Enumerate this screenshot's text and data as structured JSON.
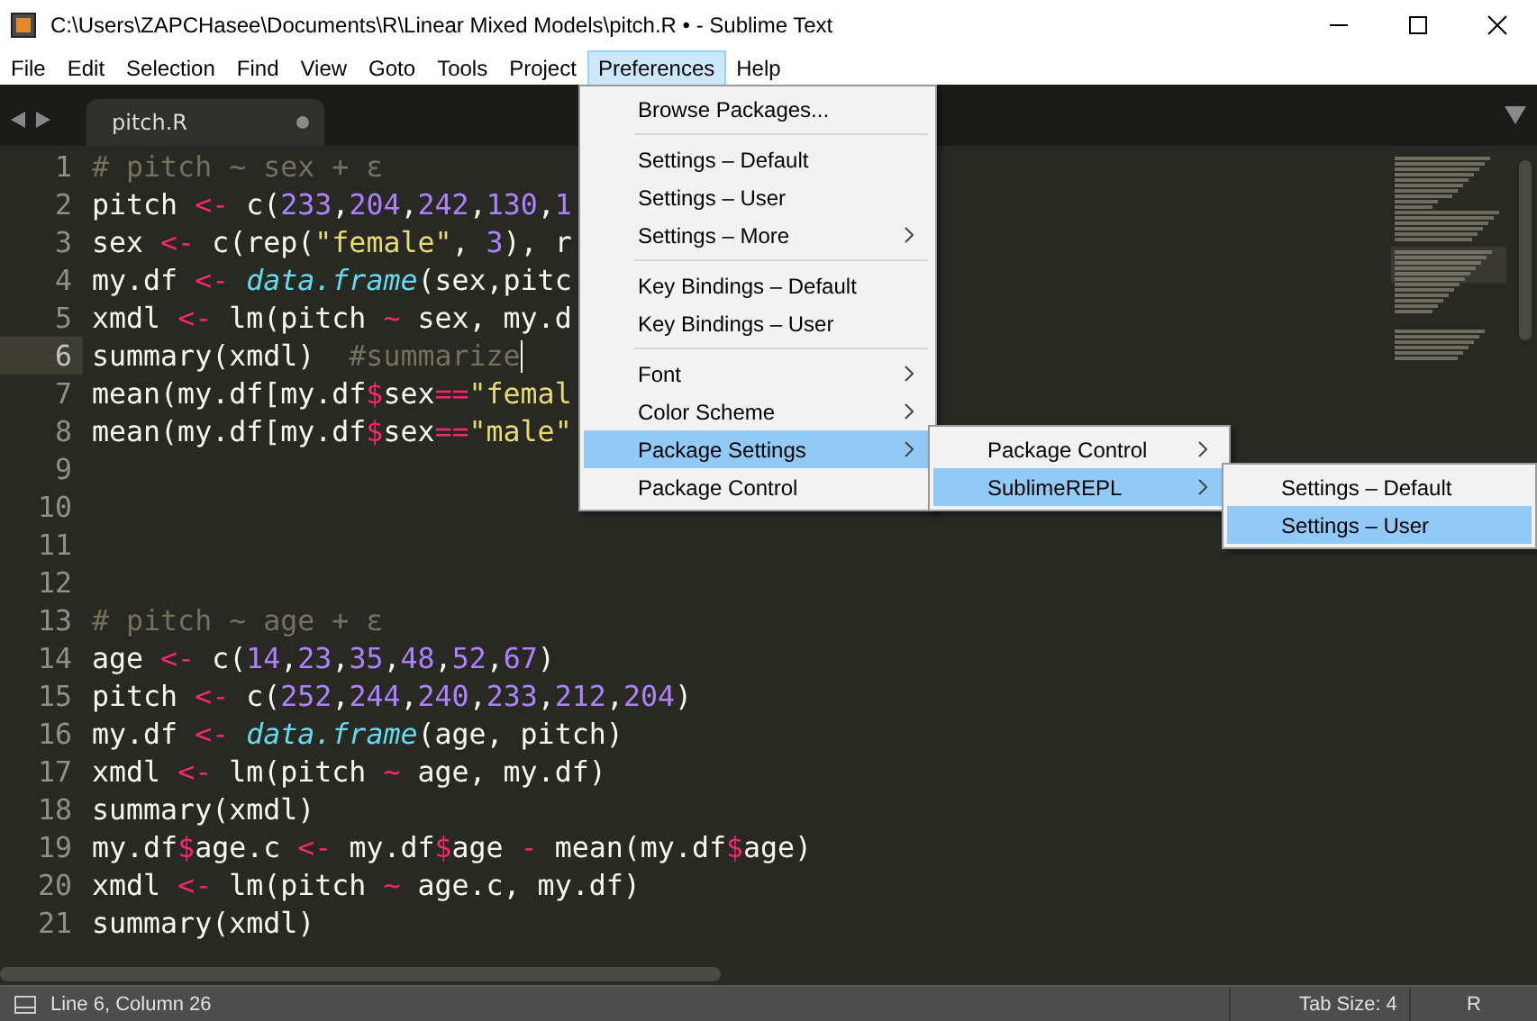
{
  "window": {
    "title": "C:\\Users\\ZAPCHasee\\Documents\\R\\Linear Mixed Models\\pitch.R • - Sublime Text"
  },
  "menubar": [
    {
      "label": "File",
      "selected": false
    },
    {
      "label": "Edit",
      "selected": false
    },
    {
      "label": "Selection",
      "selected": false
    },
    {
      "label": "Find",
      "selected": false
    },
    {
      "label": "View",
      "selected": false
    },
    {
      "label": "Goto",
      "selected": false
    },
    {
      "label": "Tools",
      "selected": false
    },
    {
      "label": "Project",
      "selected": false
    },
    {
      "label": "Preferences",
      "selected": true
    },
    {
      "label": "Help",
      "selected": false
    }
  ],
  "tabs": [
    {
      "label": "pitch.R",
      "selected": true,
      "modified": true
    }
  ],
  "editor": {
    "lines": [
      {
        "number": "1",
        "current": false,
        "tokens": [
          {
            "kind": "comment",
            "text": "# pitch ~ sex + ε"
          }
        ]
      },
      {
        "number": "2",
        "current": false,
        "tokens": [
          {
            "kind": "plain",
            "text": "pitch "
          },
          {
            "kind": "op",
            "text": "<-"
          },
          {
            "kind": "plain",
            "text": " c("
          },
          {
            "kind": "num",
            "text": "233"
          },
          {
            "kind": "plain",
            "text": ","
          },
          {
            "kind": "num",
            "text": "204"
          },
          {
            "kind": "plain",
            "text": ","
          },
          {
            "kind": "num",
            "text": "242"
          },
          {
            "kind": "plain",
            "text": ","
          },
          {
            "kind": "num",
            "text": "130"
          },
          {
            "kind": "plain",
            "text": ","
          },
          {
            "kind": "num",
            "text": "1"
          }
        ]
      },
      {
        "number": "3",
        "current": false,
        "tokens": [
          {
            "kind": "plain",
            "text": "sex "
          },
          {
            "kind": "op",
            "text": "<-"
          },
          {
            "kind": "plain",
            "text": " c(rep("
          },
          {
            "kind": "str",
            "text": "\"female\""
          },
          {
            "kind": "plain",
            "text": ", "
          },
          {
            "kind": "num",
            "text": "3"
          },
          {
            "kind": "plain",
            "text": "), r"
          }
        ]
      },
      {
        "number": "4",
        "current": false,
        "tokens": [
          {
            "kind": "plain",
            "text": "my.df "
          },
          {
            "kind": "op",
            "text": "<-"
          },
          {
            "kind": "func",
            "text": " data.frame"
          },
          {
            "kind": "plain",
            "text": "(sex,pitc"
          }
        ]
      },
      {
        "number": "5",
        "current": false,
        "tokens": [
          {
            "kind": "plain",
            "text": "xmdl "
          },
          {
            "kind": "op",
            "text": "<-"
          },
          {
            "kind": "plain",
            "text": " lm(pitch "
          },
          {
            "kind": "op",
            "text": "~"
          },
          {
            "kind": "plain",
            "text": " sex, my.d"
          }
        ]
      },
      {
        "number": "6",
        "current": true,
        "tokens": [
          {
            "kind": "plain",
            "text": "summary(xmdl)  "
          },
          {
            "kind": "comment",
            "text": "#summarize"
          }
        ]
      },
      {
        "number": "7",
        "current": false,
        "tokens": [
          {
            "kind": "plain",
            "text": "mean(my.df[my.df"
          },
          {
            "kind": "op",
            "text": "$"
          },
          {
            "kind": "plain",
            "text": "sex"
          },
          {
            "kind": "op",
            "text": "=="
          },
          {
            "kind": "str",
            "text": "\"femal"
          }
        ]
      },
      {
        "number": "8",
        "current": false,
        "tokens": [
          {
            "kind": "plain",
            "text": "mean(my.df[my.df"
          },
          {
            "kind": "op",
            "text": "$"
          },
          {
            "kind": "plain",
            "text": "sex"
          },
          {
            "kind": "op",
            "text": "=="
          },
          {
            "kind": "str",
            "text": "\"male\""
          }
        ]
      },
      {
        "number": "9",
        "current": false
      },
      {
        "number": "10",
        "current": false
      },
      {
        "number": "11",
        "current": false
      },
      {
        "number": "12",
        "current": false
      },
      {
        "number": "13",
        "current": false,
        "tokens": [
          {
            "kind": "comment",
            "text": "# pitch ~ age + ε"
          }
        ]
      },
      {
        "number": "14",
        "current": false,
        "tokens": [
          {
            "kind": "plain",
            "text": "age "
          },
          {
            "kind": "op",
            "text": "<-"
          },
          {
            "kind": "plain",
            "text": " c("
          },
          {
            "kind": "num",
            "text": "14"
          },
          {
            "kind": "plain",
            "text": ","
          },
          {
            "kind": "num",
            "text": "23"
          },
          {
            "kind": "plain",
            "text": ","
          },
          {
            "kind": "num",
            "text": "35"
          },
          {
            "kind": "plain",
            "text": ","
          },
          {
            "kind": "num",
            "text": "48"
          },
          {
            "kind": "plain",
            "text": ","
          },
          {
            "kind": "num",
            "text": "52"
          },
          {
            "kind": "plain",
            "text": ","
          },
          {
            "kind": "num",
            "text": "67"
          },
          {
            "kind": "plain",
            "text": ")"
          }
        ]
      },
      {
        "number": "15",
        "current": false,
        "tokens": [
          {
            "kind": "plain",
            "text": "pitch "
          },
          {
            "kind": "op",
            "text": "<-"
          },
          {
            "kind": "plain",
            "text": " c("
          },
          {
            "kind": "num",
            "text": "252"
          },
          {
            "kind": "plain",
            "text": ","
          },
          {
            "kind": "num",
            "text": "244"
          },
          {
            "kind": "plain",
            "text": ","
          },
          {
            "kind": "num",
            "text": "240"
          },
          {
            "kind": "plain",
            "text": ","
          },
          {
            "kind": "num",
            "text": "233"
          },
          {
            "kind": "plain",
            "text": ","
          },
          {
            "kind": "num",
            "text": "212"
          },
          {
            "kind": "plain",
            "text": ","
          },
          {
            "kind": "num",
            "text": "204"
          },
          {
            "kind": "plain",
            "text": ")"
          }
        ]
      },
      {
        "number": "16",
        "current": false,
        "tokens": [
          {
            "kind": "plain",
            "text": "my.df "
          },
          {
            "kind": "op",
            "text": "<-"
          },
          {
            "kind": "func",
            "text": " data.frame"
          },
          {
            "kind": "plain",
            "text": "(age, pitch)"
          }
        ]
      },
      {
        "number": "17",
        "current": false,
        "tokens": [
          {
            "kind": "plain",
            "text": "xmdl "
          },
          {
            "kind": "op",
            "text": "<-"
          },
          {
            "kind": "plain",
            "text": " lm(pitch "
          },
          {
            "kind": "op",
            "text": "~"
          },
          {
            "kind": "plain",
            "text": " age, my.df)"
          }
        ]
      },
      {
        "number": "18",
        "current": false,
        "tokens": [
          {
            "kind": "plain",
            "text": "summary(xmdl)"
          }
        ]
      },
      {
        "number": "19",
        "current": false,
        "tokens": [
          {
            "kind": "plain",
            "text": "my.df"
          },
          {
            "kind": "op",
            "text": "$"
          },
          {
            "kind": "plain",
            "text": "age.c "
          },
          {
            "kind": "op",
            "text": "<-"
          },
          {
            "kind": "plain",
            "text": " my.df"
          },
          {
            "kind": "op",
            "text": "$"
          },
          {
            "kind": "plain",
            "text": "age "
          },
          {
            "kind": "op",
            "text": "-"
          },
          {
            "kind": "plain",
            "text": " mean(my.df"
          },
          {
            "kind": "op",
            "text": "$"
          },
          {
            "kind": "plain",
            "text": "age)"
          }
        ]
      },
      {
        "number": "20",
        "current": false,
        "tokens": [
          {
            "kind": "plain",
            "text": "xmdl "
          },
          {
            "kind": "op",
            "text": "<-"
          },
          {
            "kind": "plain",
            "text": " lm(pitch "
          },
          {
            "kind": "op",
            "text": "~"
          },
          {
            "kind": "plain",
            "text": " age.c, my.df)"
          }
        ]
      },
      {
        "number": "21",
        "current": false,
        "tokens": [
          {
            "kind": "plain",
            "text": "summary(xmdl)"
          }
        ]
      }
    ]
  },
  "menus": [
    {
      "items": [
        {
          "kind": "item",
          "label": "Browse Packages...",
          "submenu": false,
          "selected": false
        },
        {
          "kind": "separator"
        },
        {
          "kind": "item",
          "label": "Settings – Default",
          "submenu": false,
          "selected": false
        },
        {
          "kind": "item",
          "label": "Settings – User",
          "submenu": false,
          "selected": false
        },
        {
          "kind": "item",
          "label": "Settings – More",
          "submenu": true,
          "selected": false
        },
        {
          "kind": "separator"
        },
        {
          "kind": "item",
          "label": "Key Bindings – Default",
          "submenu": false,
          "selected": false
        },
        {
          "kind": "item",
          "label": "Key Bindings – User",
          "submenu": false,
          "selected": false
        },
        {
          "kind": "separator"
        },
        {
          "kind": "item",
          "label": "Font",
          "submenu": true,
          "selected": false
        },
        {
          "kind": "item",
          "label": "Color Scheme",
          "submenu": true,
          "selected": false
        },
        {
          "kind": "item",
          "label": "Package Settings",
          "submenu": true,
          "selected": true
        },
        {
          "kind": "item",
          "label": "Package Control",
          "submenu": false,
          "selected": false
        }
      ]
    },
    {
      "items": [
        {
          "kind": "item",
          "label": "Package Control",
          "submenu": true,
          "selected": false
        },
        {
          "kind": "item",
          "label": "SublimeREPL",
          "submenu": true,
          "selected": true
        }
      ]
    },
    {
      "items": [
        {
          "kind": "item",
          "label": "Settings – Default",
          "submenu": false,
          "selected": false
        },
        {
          "kind": "item",
          "label": "Settings – User",
          "submenu": false,
          "selected": true
        }
      ]
    }
  ],
  "status_bar": {
    "position": "Line 6, Column 26",
    "tab_size": "Tab Size: 4",
    "syntax": "R"
  }
}
